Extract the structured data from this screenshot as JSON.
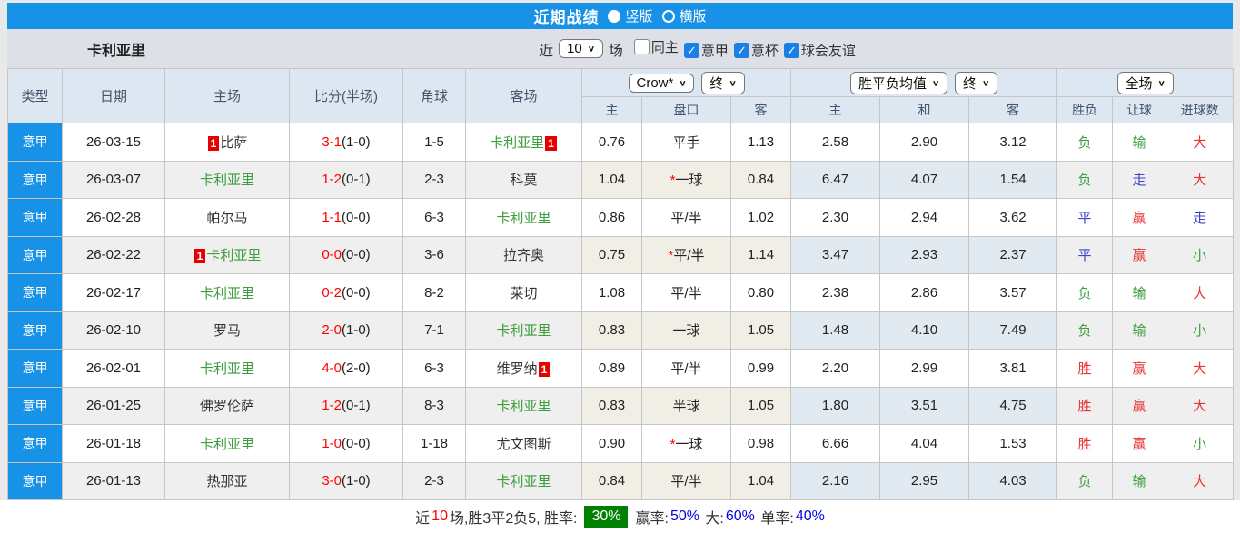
{
  "topbar": {
    "title": "近期战绩",
    "radios": [
      {
        "label": "竖版",
        "selected": true
      },
      {
        "label": "横版",
        "selected": false
      }
    ]
  },
  "filterbar": {
    "team": "卡利亚里",
    "near_label": "近",
    "count": "10",
    "games_label": "场",
    "checkboxes": [
      {
        "label": "同主",
        "checked": false
      },
      {
        "label": "意甲",
        "checked": true
      },
      {
        "label": "意杯",
        "checked": true
      },
      {
        "label": "球会友谊",
        "checked": true
      }
    ]
  },
  "table": {
    "static_headers": [
      "类型",
      "日期",
      "主场",
      "比分(半场)",
      "角球",
      "客场"
    ],
    "selects": {
      "odds_company": "Crow*",
      "odds_time": "终",
      "mean": "胜平负均值",
      "mean_time": "终",
      "scope": "全场"
    },
    "sub_headers": [
      "主",
      "盘口",
      "客",
      "主",
      "和",
      "客",
      "胜负",
      "让球",
      "进球数"
    ],
    "rows": [
      {
        "league": "意甲",
        "date": "26-03-15",
        "home": {
          "name": "比萨",
          "green": false,
          "badge": "before"
        },
        "score": {
          "full": "3-1",
          "half": "(1-0)"
        },
        "corners": "1-5",
        "away": {
          "name": "卡利亚里",
          "green": true,
          "badge": "after"
        },
        "odds_home": "0.76",
        "handicap": {
          "star": false,
          "text": "平手"
        },
        "odds_away": "1.13",
        "mean": [
          "2.58",
          "2.90",
          "3.12"
        ],
        "results": [
          {
            "t": "负",
            "c": "green"
          },
          {
            "t": "输",
            "c": "green"
          },
          {
            "t": "大",
            "c": "red"
          }
        ]
      },
      {
        "league": "意甲",
        "date": "26-03-07",
        "home": {
          "name": "卡利亚里",
          "green": true,
          "badge": null
        },
        "score": {
          "full": "1-2",
          "half": "(0-1)"
        },
        "corners": "2-3",
        "away": {
          "name": "科莫",
          "green": false,
          "badge": null
        },
        "odds_home": "1.04",
        "handicap": {
          "star": true,
          "text": "一球"
        },
        "odds_away": "0.84",
        "mean": [
          "6.47",
          "4.07",
          "1.54"
        ],
        "results": [
          {
            "t": "负",
            "c": "green"
          },
          {
            "t": "走",
            "c": "blue"
          },
          {
            "t": "大",
            "c": "red"
          }
        ]
      },
      {
        "league": "意甲",
        "date": "26-02-28",
        "home": {
          "name": "帕尔马",
          "green": false,
          "badge": null
        },
        "score": {
          "full": "1-1",
          "half": "(0-0)"
        },
        "corners": "6-3",
        "away": {
          "name": "卡利亚里",
          "green": true,
          "badge": null
        },
        "odds_home": "0.86",
        "handicap": {
          "star": false,
          "text": "平/半"
        },
        "odds_away": "1.02",
        "mean": [
          "2.30",
          "2.94",
          "3.62"
        ],
        "results": [
          {
            "t": "平",
            "c": "blue"
          },
          {
            "t": "赢",
            "c": "red"
          },
          {
            "t": "走",
            "c": "blue"
          }
        ]
      },
      {
        "league": "意甲",
        "date": "26-02-22",
        "home": {
          "name": "卡利亚里",
          "green": true,
          "badge": "before"
        },
        "score": {
          "full": "0-0",
          "half": "(0-0)"
        },
        "corners": "3-6",
        "away": {
          "name": "拉齐奥",
          "green": false,
          "badge": null
        },
        "odds_home": "0.75",
        "handicap": {
          "star": true,
          "text": "平/半"
        },
        "odds_away": "1.14",
        "mean": [
          "3.47",
          "2.93",
          "2.37"
        ],
        "results": [
          {
            "t": "平",
            "c": "blue"
          },
          {
            "t": "赢",
            "c": "red"
          },
          {
            "t": "小",
            "c": "green"
          }
        ]
      },
      {
        "league": "意甲",
        "date": "26-02-17",
        "home": {
          "name": "卡利亚里",
          "green": true,
          "badge": null
        },
        "score": {
          "full": "0-2",
          "half": "(0-0)"
        },
        "corners": "8-2",
        "away": {
          "name": "莱切",
          "green": false,
          "badge": null
        },
        "odds_home": "1.08",
        "handicap": {
          "star": false,
          "text": "平/半"
        },
        "odds_away": "0.80",
        "mean": [
          "2.38",
          "2.86",
          "3.57"
        ],
        "results": [
          {
            "t": "负",
            "c": "green"
          },
          {
            "t": "输",
            "c": "green"
          },
          {
            "t": "大",
            "c": "red"
          }
        ]
      },
      {
        "league": "意甲",
        "date": "26-02-10",
        "home": {
          "name": "罗马",
          "green": false,
          "badge": null
        },
        "score": {
          "full": "2-0",
          "half": "(1-0)"
        },
        "corners": "7-1",
        "away": {
          "name": "卡利亚里",
          "green": true,
          "badge": null
        },
        "odds_home": "0.83",
        "handicap": {
          "star": false,
          "text": "一球"
        },
        "odds_away": "1.05",
        "mean": [
          "1.48",
          "4.10",
          "7.49"
        ],
        "results": [
          {
            "t": "负",
            "c": "green"
          },
          {
            "t": "输",
            "c": "green"
          },
          {
            "t": "小",
            "c": "green"
          }
        ]
      },
      {
        "league": "意甲",
        "date": "26-02-01",
        "home": {
          "name": "卡利亚里",
          "green": true,
          "badge": null
        },
        "score": {
          "full": "4-0",
          "half": "(2-0)"
        },
        "corners": "6-3",
        "away": {
          "name": "维罗纳",
          "green": false,
          "badge": "after"
        },
        "odds_home": "0.89",
        "handicap": {
          "star": false,
          "text": "平/半"
        },
        "odds_away": "0.99",
        "mean": [
          "2.20",
          "2.99",
          "3.81"
        ],
        "results": [
          {
            "t": "胜",
            "c": "red"
          },
          {
            "t": "赢",
            "c": "red"
          },
          {
            "t": "大",
            "c": "red"
          }
        ]
      },
      {
        "league": "意甲",
        "date": "26-01-25",
        "home": {
          "name": "佛罗伦萨",
          "green": false,
          "badge": null
        },
        "score": {
          "full": "1-2",
          "half": "(0-1)"
        },
        "corners": "8-3",
        "away": {
          "name": "卡利亚里",
          "green": true,
          "badge": null
        },
        "odds_home": "0.83",
        "handicap": {
          "star": false,
          "text": "半球"
        },
        "odds_away": "1.05",
        "mean": [
          "1.80",
          "3.51",
          "4.75"
        ],
        "results": [
          {
            "t": "胜",
            "c": "red"
          },
          {
            "t": "赢",
            "c": "red"
          },
          {
            "t": "大",
            "c": "red"
          }
        ]
      },
      {
        "league": "意甲",
        "date": "26-01-18",
        "home": {
          "name": "卡利亚里",
          "green": true,
          "badge": null
        },
        "score": {
          "full": "1-0",
          "half": "(0-0)"
        },
        "corners": "1-18",
        "away": {
          "name": "尤文图斯",
          "green": false,
          "badge": null
        },
        "odds_home": "0.90",
        "handicap": {
          "star": true,
          "text": "一球"
        },
        "odds_away": "0.98",
        "mean": [
          "6.66",
          "4.04",
          "1.53"
        ],
        "results": [
          {
            "t": "胜",
            "c": "red"
          },
          {
            "t": "赢",
            "c": "red"
          },
          {
            "t": "小",
            "c": "green"
          }
        ]
      },
      {
        "league": "意甲",
        "date": "26-01-13",
        "home": {
          "name": "热那亚",
          "green": false,
          "badge": null
        },
        "score": {
          "full": "3-0",
          "half": "(1-0)"
        },
        "corners": "2-3",
        "away": {
          "name": "卡利亚里",
          "green": true,
          "badge": null
        },
        "odds_home": "0.84",
        "handicap": {
          "star": false,
          "text": "平/半"
        },
        "odds_away": "1.04",
        "mean": [
          "2.16",
          "2.95",
          "4.03"
        ],
        "results": [
          {
            "t": "负",
            "c": "green"
          },
          {
            "t": "输",
            "c": "green"
          },
          {
            "t": "大",
            "c": "red"
          }
        ]
      }
    ]
  },
  "summary": {
    "parts": [
      {
        "t": "近",
        "c": "black"
      },
      {
        "t": "10",
        "c": "red"
      },
      {
        "t": "场,胜3平2负5, 胜率:",
        "c": "black"
      },
      {
        "t": "30%",
        "c": "badge"
      },
      {
        "t": "赢率:",
        "c": "black"
      },
      {
        "t": "50%",
        "c": "blue"
      },
      {
        "t": " 大:",
        "c": "black"
      },
      {
        "t": "60%",
        "c": "blue"
      },
      {
        "t": " 单率:",
        "c": "black"
      },
      {
        "t": "40%",
        "c": "blue"
      }
    ]
  },
  "colors": {
    "accent_blue": "#1792e6",
    "result_red": "#e83333",
    "result_blue": "#4141cc",
    "result_green": "#3c9e3c",
    "score_red": "#ff0000",
    "badge_red": "#e60000",
    "summary_badge_green": "#008000"
  }
}
